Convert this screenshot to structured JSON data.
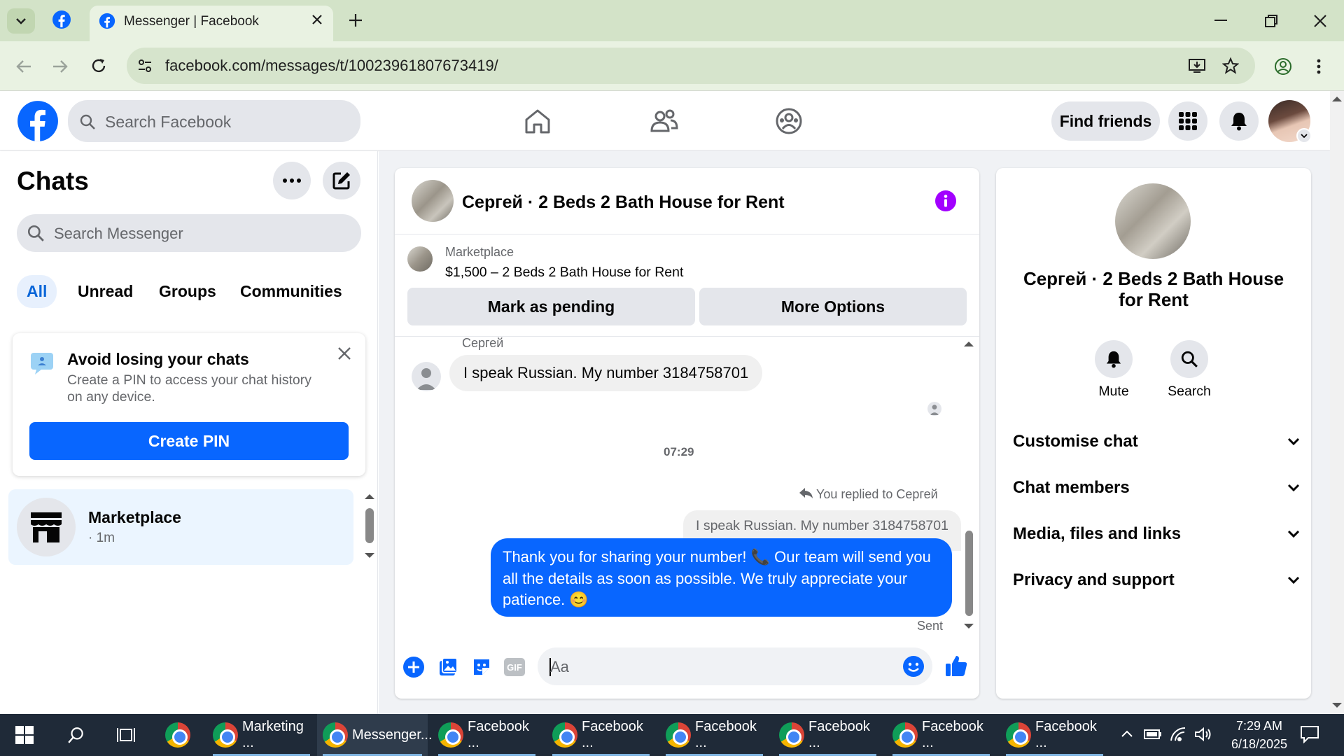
{
  "browser": {
    "tab_title": "Messenger | Facebook",
    "url": "facebook.com/messages/t/10023961807673419/"
  },
  "fb": {
    "search_placeholder": "Search Facebook",
    "find_friends": "Find friends"
  },
  "left": {
    "title": "Chats",
    "search_placeholder": "Search Messenger",
    "filters": [
      "All",
      "Unread",
      "Groups",
      "Communities"
    ],
    "pin_card": {
      "title": "Avoid losing your chats",
      "body": "Create a PIN to access your chat history on any device.",
      "button": "Create PIN"
    },
    "chat_item": {
      "name": "Marketplace",
      "time": "· 1m"
    }
  },
  "chat": {
    "title": "Сергей · 2 Beds 2 Bath House for Rent",
    "listing_source": "Marketplace",
    "listing_desc": "$1,500 – 2 Beds 2 Bath House for Rent",
    "mark_pending": "Mark as pending",
    "more_options": "More Options",
    "sender_name": "Сергей",
    "incoming_msg": "I speak Russian. My number 3184758701",
    "time_divider": "07:29",
    "replied_to": "You replied to Сергей",
    "quoted_msg": "I speak Russian. My number 3184758701",
    "outgoing_msg": "Thank you for sharing your number! 📞 Our team will send you all the details as soon as possible. We truly appreciate your patience. 😊",
    "status": "Sent",
    "composer_placeholder": "Aa",
    "gif_label": "GIF"
  },
  "right": {
    "title": "Сергей · 2 Beds 2 Bath House for Rent",
    "mute": "Mute",
    "search": "Search",
    "sections": [
      "Customise chat",
      "Chat members",
      "Media, files and links",
      "Privacy and support"
    ]
  },
  "taskbar": {
    "apps": [
      "Marketing ...",
      "Messenger...",
      "Facebook ...",
      "Facebook ...",
      "Facebook ...",
      "Facebook ...",
      "Facebook ...",
      "Facebook ..."
    ],
    "time": "7:29 AM",
    "date": "6/18/2025"
  },
  "colors": {
    "fb_blue": "#0866ff",
    "accent_purple": "#a200ff"
  }
}
